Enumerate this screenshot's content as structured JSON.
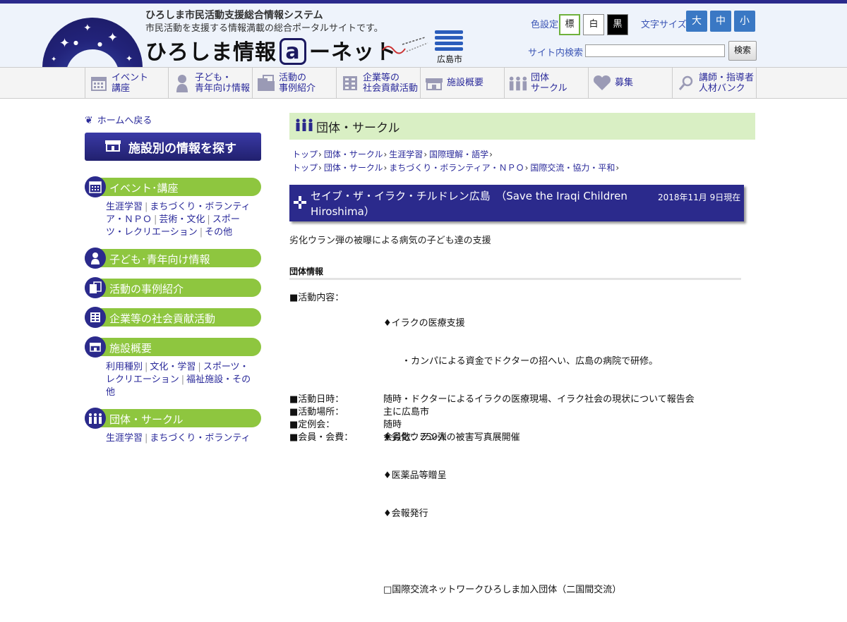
{
  "header": {
    "tagline1": "ひろしま市民活動支援総合情報システム",
    "tagline2": "市民活動を支援する情報満載の総合ポータルサイトです。",
    "logo_pre": "ひろしま情報",
    "logo_a": "a",
    "logo_post": "ーネット",
    "city": "広島市",
    "color_label": "色設定",
    "color_options": [
      "標",
      "白",
      "黒"
    ],
    "size_label": "文字サイズ",
    "size_options": [
      "大",
      "中",
      "小"
    ],
    "search_label": "サイト内検索",
    "search_button": "検索",
    "search_value": ""
  },
  "nav": [
    {
      "label": "イベント\n講座",
      "icon": "calendar-icon"
    },
    {
      "label": "子ども・\n青年向け情報",
      "icon": "child-icon"
    },
    {
      "label": "活動の\n事例紹介",
      "icon": "documents-icon"
    },
    {
      "label": "企業等の\n社会貢献活動",
      "icon": "building-icon"
    },
    {
      "label": "施設概要",
      "icon": "facility-icon"
    },
    {
      "label": "団体\nサークル",
      "icon": "group-icon"
    },
    {
      "label": "募集",
      "icon": "heart-icon"
    },
    {
      "label": "講師・指導者\n人材バンク",
      "icon": "magnifier-icon"
    }
  ],
  "sidebar": {
    "home_link": "ホームへ戻る",
    "facility_button": "施設別の情報を探す",
    "categories": [
      {
        "label": "イベント･講座",
        "links": [
          "生涯学習",
          "まちづくり・ボランティア・ＮＰＯ",
          "芸術・文化",
          "スポーツ・レクリエーション",
          "その他"
        ]
      },
      {
        "label": "子ども･青年向け情報"
      },
      {
        "label": "活動の事例紹介"
      },
      {
        "label": "企業等の社会貢献活動"
      },
      {
        "label": "施設概要",
        "links": [
          "利用種別",
          "文化・学習",
          "スポーツ・レクリエーション",
          "福祉施設・その他"
        ]
      },
      {
        "label": "団体・サークル",
        "links": [
          "生涯学習",
          "まちづくり・ボランティ"
        ]
      }
    ]
  },
  "main": {
    "section_title": "団体・サークル",
    "breadcrumbs": [
      [
        "トップ",
        "団体・サークル",
        "生涯学習",
        "国際理解・語学"
      ],
      [
        "トップ",
        "団体・サークル",
        "まちづくり・ボランティア・ＮＰＯ",
        "国際交流・協力・平和"
      ]
    ],
    "org_title": "セイブ・ザ・イラク・チルドレン広島　（Save the Iraqi Children Hiroshima）",
    "org_date": "2018年11月 9日現在",
    "description": "劣化ウラン弾の被曝による病気の子ども達の支援",
    "info_heading": "団体情報",
    "rows": [
      {
        "key": "■活動内容：",
        "lines": [
          "♦イラクの医療支援",
          "　　・カンパによる資金でドクターの招へい、広島の病院で研修。",
          "　　・ドクターによるイラクの医療現場、イラク社会の現状について報告会",
          "♦劣化ウラン弾の被害写真展開催",
          "♦医薬品等贈呈",
          "♦会報発行",
          "",
          "□国際交流ネットワークひろしま加入団体（二国間交流）"
        ]
      },
      {
        "key": "■活動日時：",
        "lines": [
          "随時"
        ]
      },
      {
        "key": "■活動場所：",
        "lines": [
          "主に広島市"
        ]
      },
      {
        "key": "■定例会：",
        "lines": [
          "随時"
        ]
      },
      {
        "key": "■会員・会費：",
        "lines": [
          "会員数：250人"
        ]
      }
    ]
  }
}
